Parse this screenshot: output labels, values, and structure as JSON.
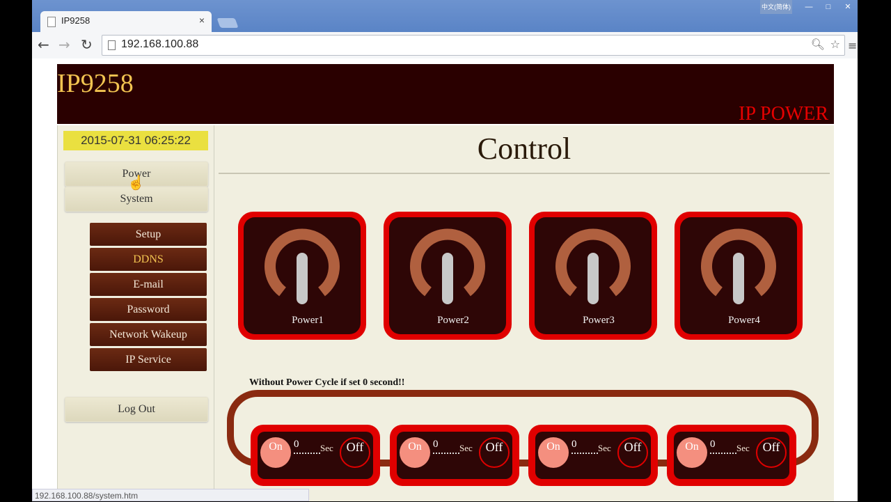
{
  "browser": {
    "tab_title": "IP9258",
    "tab_close": "×",
    "ime_label": "中文(简体)",
    "url": "192.168.100.88",
    "status_url": "192.168.100.88/system.htm"
  },
  "header": {
    "brand": "IP9258",
    "tagline": "IP POWER"
  },
  "sidebar": {
    "clock": "2015-07-31 06:25:22",
    "top_menu": [
      "Power",
      "System"
    ],
    "sub_menu": [
      "Setup",
      "DDNS",
      "E-mail",
      "Password",
      "Network Wakeup",
      "IP Service"
    ],
    "active_item": "DDNS",
    "logout": "Log Out"
  },
  "main": {
    "title": "Control",
    "outlets": [
      "Power1",
      "Power2",
      "Power3",
      "Power4"
    ],
    "cycle_note": "Without Power Cycle if set 0 second!!",
    "timers": [
      {
        "on": "On",
        "value": "0",
        "unit": "Sec",
        "off": "Off"
      },
      {
        "on": "On",
        "value": "0",
        "unit": "Sec",
        "off": "Off"
      },
      {
        "on": "On",
        "value": "0",
        "unit": "Sec",
        "off": "Off"
      },
      {
        "on": "On",
        "value": "0",
        "unit": "Sec",
        "off": "Off"
      }
    ]
  },
  "colors": {
    "header_bg": "#2a0000",
    "brand": "#f2c451",
    "accent_red": "#e00000",
    "power_arc": "#b0603f",
    "clock_bg": "#eae040"
  }
}
